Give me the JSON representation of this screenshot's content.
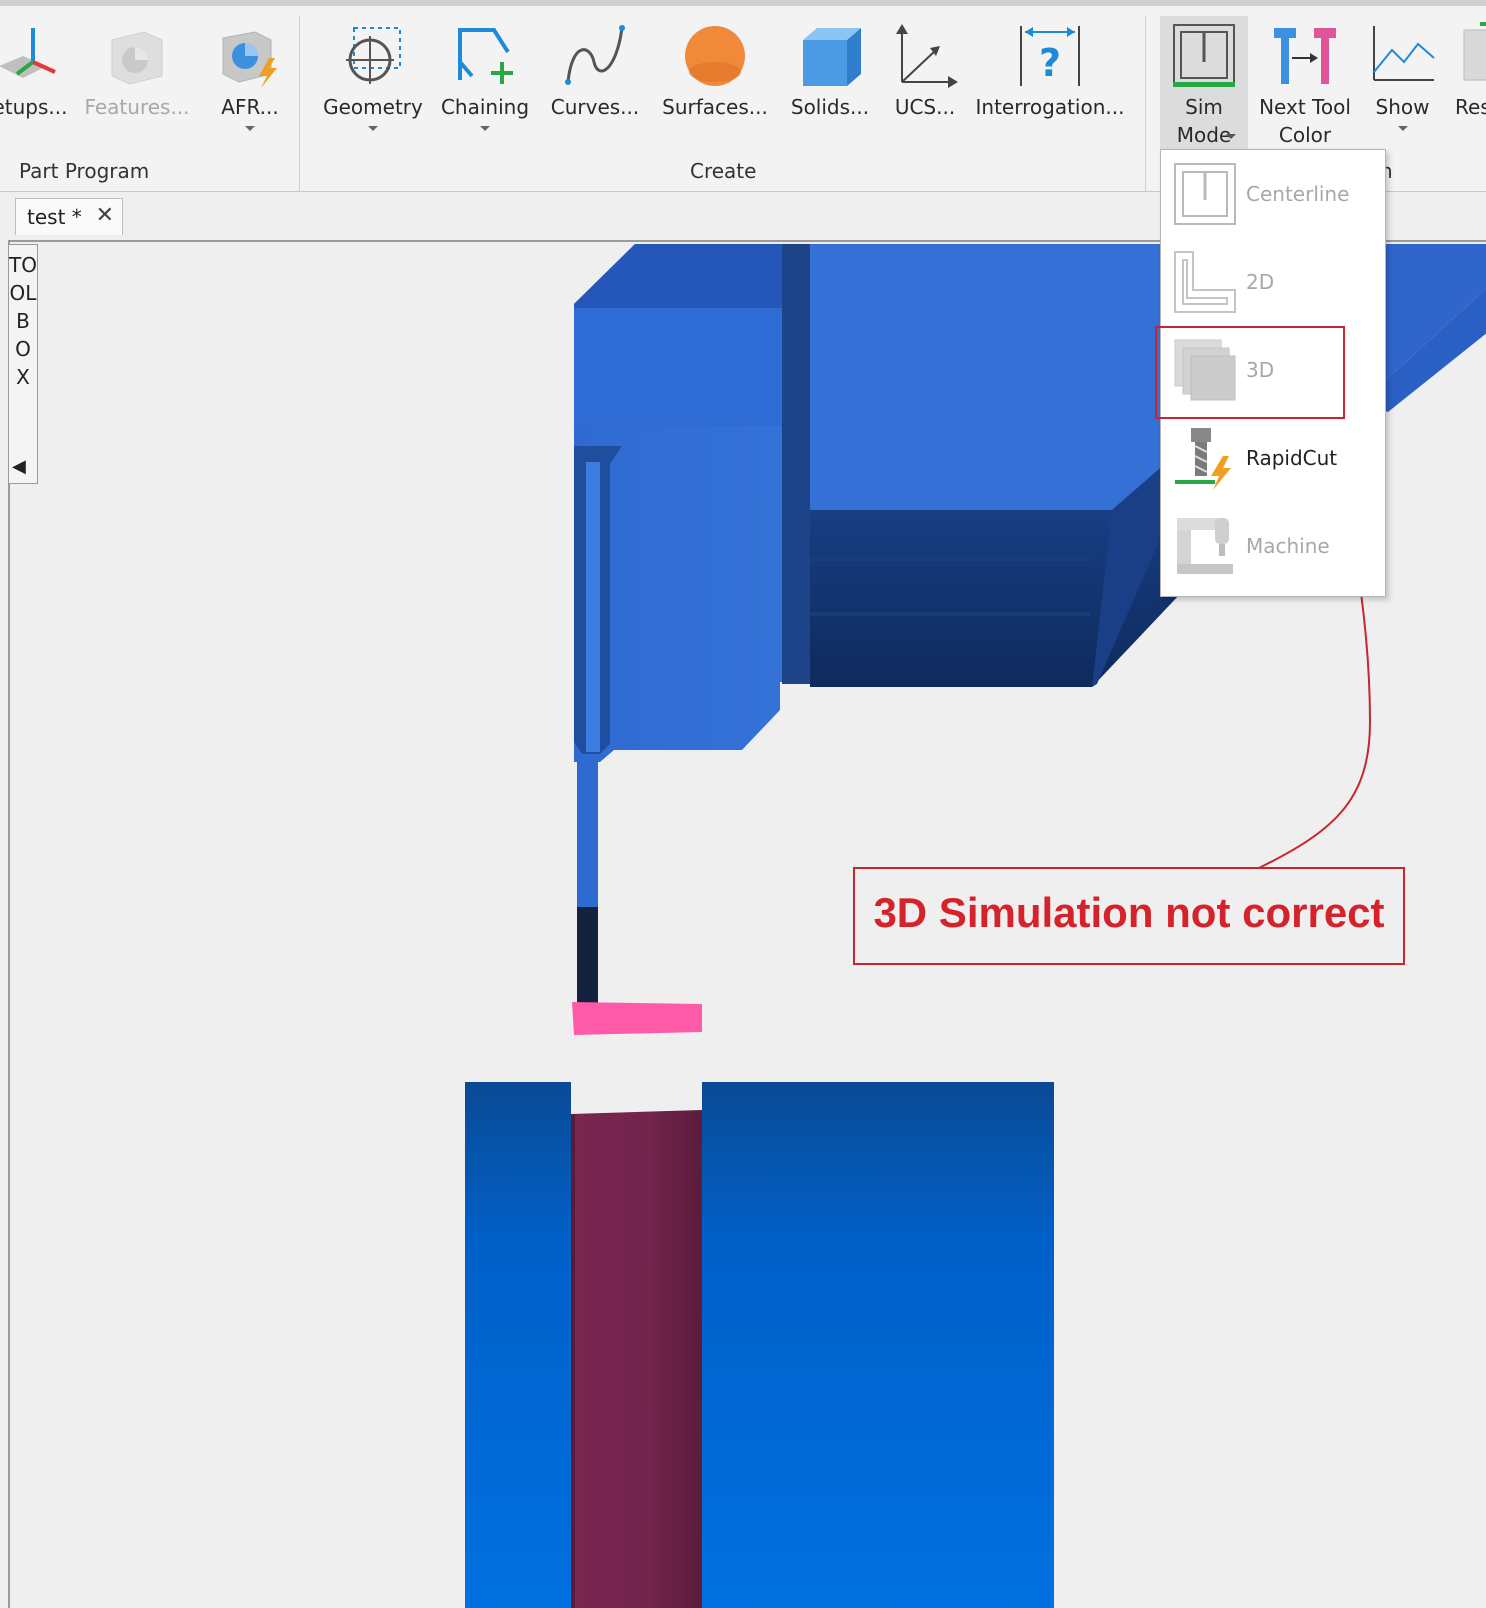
{
  "ribbon": {
    "groups": [
      {
        "label": "Part Program"
      },
      {
        "label": "Create"
      },
      {
        "label": "n"
      }
    ],
    "buttons": [
      {
        "label": "etups..."
      },
      {
        "label": "Features..."
      },
      {
        "label": "AFR..."
      },
      {
        "label": "Geometry"
      },
      {
        "label": "Chaining"
      },
      {
        "label": "Curves..."
      },
      {
        "label": "Surfaces..."
      },
      {
        "label": "Solids..."
      },
      {
        "label": "UCS..."
      },
      {
        "label": "Interrogation..."
      },
      {
        "label": "Sim",
        "label2": "Mode"
      },
      {
        "label": "Next Tool",
        "label2": "Color"
      },
      {
        "label": "Show"
      },
      {
        "label": "Res"
      }
    ]
  },
  "tabs": [
    {
      "label": "test *",
      "close": "✕"
    }
  ],
  "toolbox": {
    "label": "TOOLBOX",
    "arrow": "◀"
  },
  "sim_mode_menu": {
    "items": [
      {
        "label": "Centerline",
        "enabled": false
      },
      {
        "label": "2D",
        "enabled": false
      },
      {
        "label": "3D",
        "enabled": false
      },
      {
        "label": "RapidCut",
        "enabled": true
      },
      {
        "label": "Machine",
        "enabled": false
      }
    ]
  },
  "annotation": {
    "text": "3D Simulation not correct",
    "color": "#d5232c"
  },
  "colors": {
    "part_blue": "#0070e0",
    "part_dark": "#1a3566",
    "stock_maroon": "#7a2650",
    "tool_pink": "#ff5aa8"
  }
}
